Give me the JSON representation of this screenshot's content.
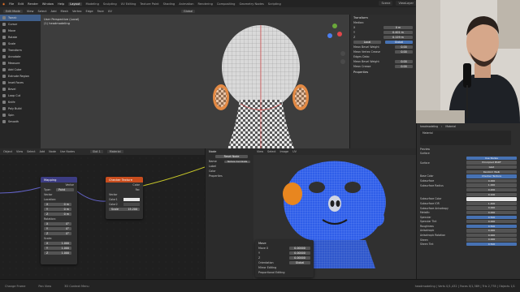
{
  "menubar": {
    "items": [
      "File",
      "Edit",
      "Render",
      "Window",
      "Help"
    ],
    "workspaces": [
      "Layout",
      "Modeling",
      "Sculpting",
      "UV Editing",
      "Texture Paint",
      "Shading",
      "Animation",
      "Rendering",
      "Compositing",
      "Geometry Nodes",
      "Scripting"
    ],
    "active_workspace": "Layout",
    "scene": "Scene",
    "view_layer": "ViewLayer"
  },
  "viewport": {
    "mode": "Edit Mode",
    "menus": [
      "View",
      "Select",
      "Add",
      "Mesh",
      "Vertex",
      "Edge",
      "Face",
      "UV"
    ],
    "orientation": "Global",
    "title_line1": "User Perspective (Local)",
    "title_line2": "(1) headmodeling"
  },
  "toolpanel": {
    "tools": [
      "Tweak",
      "Cursor",
      "Move",
      "Rotate",
      "Scale",
      "Transform",
      "Annotate",
      "Measure",
      "Add Cube",
      "Extrude Region",
      "Inset Faces",
      "Bevel",
      "Loop Cut",
      "Knife",
      "Poly Build",
      "Spin",
      "Smooth"
    ],
    "selected_index": 0
  },
  "npanel": {
    "header": "Transform",
    "median_label": "Median:",
    "rows": [
      {
        "label": "X",
        "value": "0 m"
      },
      {
        "label": "Y",
        "value": "0.401 m"
      },
      {
        "label": "Z",
        "value": "0.129 m"
      }
    ],
    "space_local": "Local",
    "space_global": "Global",
    "mean_rows": [
      {
        "label": "Mean Bevel Weight",
        "value": "0.00"
      },
      {
        "label": "Mean Vertex Crease",
        "value": "0.00"
      }
    ],
    "edges_label": "Edges Data:",
    "edge_rows": [
      {
        "label": "Mean Bevel Weight",
        "value": "0.00"
      },
      {
        "label": "Mean Crease",
        "value": "0.00"
      }
    ],
    "properties_label": "Properties"
  },
  "node_editor": {
    "header_items": [
      "Object",
      "View",
      "Select",
      "Add",
      "Node",
      "Use Nodes"
    ],
    "slot": "Slot 1",
    "material": "Material",
    "mapping": {
      "title": "Mapping",
      "out": "Vector",
      "type_label": "Type:",
      "type_value": "Point",
      "in_vector": "Vector",
      "location_label": "Location:",
      "location": [
        {
          "axis": "X",
          "value": "0 m"
        },
        {
          "axis": "Y",
          "value": "0 m"
        },
        {
          "axis": "Z",
          "value": "0 m"
        }
      ],
      "rotation_label": "Rotation:",
      "rotation": [
        {
          "axis": "X",
          "value": "0°"
        },
        {
          "axis": "Y",
          "value": "0°"
        },
        {
          "axis": "Z",
          "value": "0°"
        }
      ],
      "scale_label": "Scale:",
      "scale": [
        {
          "axis": "X",
          "value": "1.000"
        },
        {
          "axis": "Y",
          "value": "1.000"
        },
        {
          "axis": "Z",
          "value": "1.000"
        }
      ]
    },
    "checker": {
      "title": "Checker Texture",
      "out_color": "Color",
      "out_fac": "Fac",
      "in_vector": "Vector",
      "color1": "Color1",
      "color2": "Color2",
      "scale_label": "Scale",
      "scale_value": "15.200"
    }
  },
  "node_props": {
    "header": "Node",
    "reset": "Reset Node",
    "name_label": "Name",
    "name_value": "Texture Coordinate",
    "label_label": "Label",
    "color_label": "Color",
    "properties_label": "Properties"
  },
  "uv_editor": {
    "header_items": [
      "View",
      "Select",
      "Image",
      "UV"
    ],
    "panel_title": "Move",
    "panel_rows": [
      {
        "label": "Move X",
        "value": "0.00000"
      },
      {
        "label": "Y",
        "value": "0.00000"
      },
      {
        "label": "Z",
        "value": "0.00000"
      }
    ],
    "orientation_label": "Orientation",
    "orientation_value": "Global",
    "mirror": "Mirror Editing",
    "proportional": "Proportional Editing"
  },
  "properties": {
    "breadcrumb_obj": "headmodeling",
    "breadcrumb_mat": "Material",
    "material_slot": "Material",
    "tabs": [
      "Preview",
      "Surface"
    ],
    "use_nodes": "Use Nodes",
    "surface_label": "Surface",
    "surface_value": "Principled BSDF",
    "rows": [
      {
        "label": "GGX",
        "value": ""
      },
      {
        "label": "Random Walk",
        "value": ""
      },
      {
        "label": "Base Color",
        "value": "Checker Texture",
        "style": "blue"
      },
      {
        "label": "Subsurface",
        "value": "0.000"
      },
      {
        "label": "Subsurface Radius",
        "value": "1.000"
      },
      {
        "label": "",
        "value": "0.200"
      },
      {
        "label": "",
        "value": "0.100"
      },
      {
        "label": "Subsurface Color",
        "value": "",
        "style": "dark"
      },
      {
        "label": "Subsurface IOR",
        "value": "1.400"
      },
      {
        "label": "Subsurface Anisotropy",
        "value": "0.000"
      },
      {
        "label": "Metallic",
        "value": "0.000"
      },
      {
        "label": "Specular",
        "value": "0.500"
      },
      {
        "label": "Specular Tint",
        "value": "0.000"
      },
      {
        "label": "Roughness",
        "value": "0.500"
      },
      {
        "label": "Anisotropic",
        "value": "0.000"
      },
      {
        "label": "Anisotropic Rotation",
        "value": "0.000"
      },
      {
        "label": "Sheen",
        "value": "0.000"
      },
      {
        "label": "Sheen Tint",
        "value": "0.500"
      }
    ]
  },
  "statusbar": {
    "left1": "Change Frame",
    "left2": "Pan View",
    "left3": "3D Context Menu",
    "right": "headmodeling | Verts 0/1,432 | Faces 0/1,389 | Tris 2,778 | Objects 1/1"
  },
  "colors": {
    "accent": "#4772b3",
    "mapping_header": "#3c3c83",
    "checker_header": "#c84d1e",
    "uv_mesh": "#3a5fff"
  }
}
